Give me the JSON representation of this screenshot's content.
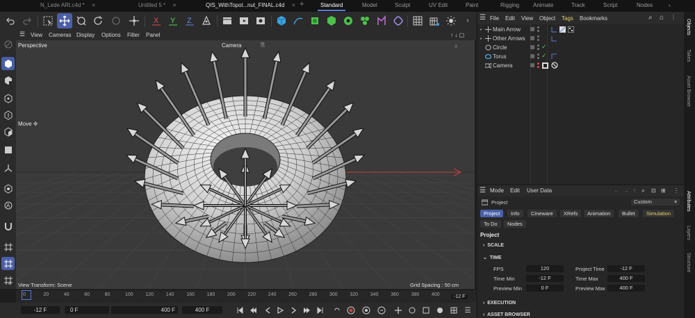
{
  "doc_tabs": [
    {
      "label": "N_Lede ARt.c4d *",
      "active": false
    },
    {
      "label": "Untitled 5 *",
      "active": false
    },
    {
      "label": "QIS_WithTopol...nut_FINAL.c4d",
      "active": true
    }
  ],
  "new_tab_symbol": "+",
  "layouts": [
    "Standard",
    "Model",
    "Sculpt",
    "UV Edit",
    "Paint",
    "Rigging",
    "Animate",
    "Track",
    "Script",
    "Nodes"
  ],
  "viewport_menu": {
    "items": [
      "View",
      "Cameras",
      "Display",
      "Options",
      "Filter",
      "Panel"
    ]
  },
  "viewport": {
    "view_name": "Perspective",
    "camera_label": "Camera",
    "tool_label": "Move",
    "transform_label": "View Transform: Scene",
    "grid_spacing": "Grid Spacing : 50 cm"
  },
  "timeline": {
    "ticks": [
      "0",
      "20",
      "40",
      "60",
      "80",
      "100",
      "120",
      "140",
      "160",
      "180",
      "200",
      "220",
      "240",
      "260",
      "280",
      "300",
      "320",
      "340",
      "360",
      "380",
      "400"
    ],
    "current_frame_badge": "-12 F",
    "start_field": "-12 F",
    "current_field": "0 F",
    "end_field": "400 F",
    "max_field": "400 F"
  },
  "object_manager": {
    "menu": [
      "File",
      "Edit",
      "View",
      "Object",
      "Tags",
      "Bookmarks"
    ],
    "objects": [
      {
        "name": "Main Arrow",
        "icon": "null-icon"
      },
      {
        "name": "Other Arrows",
        "icon": "null-icon"
      },
      {
        "name": "Circle",
        "icon": "circle-spline-icon"
      },
      {
        "name": "Torus",
        "icon": "torus-icon"
      },
      {
        "name": "Camera",
        "icon": "camera-icon"
      }
    ]
  },
  "attributes": {
    "menu": [
      "Mode",
      "Edit",
      "User Data"
    ],
    "object_label": "Project",
    "preset": "Custom",
    "tabs": [
      "Project",
      "Info",
      "Cineware",
      "XRefs",
      "Animation",
      "Bullet",
      "Simulation"
    ],
    "tabs_row2": [
      "To Do",
      "Nodes"
    ],
    "heading": "Project",
    "sections": {
      "scale": "SCALE",
      "time": "TIME",
      "execution": "EXECUTION",
      "asset_browser": "ASSET BROWSER"
    },
    "fields": {
      "fps_label": "FPS",
      "fps_value": "120",
      "project_time_label": "Project Time",
      "project_time_value": "-12 F",
      "time_min_label": "Time Min",
      "time_min_value": "-12 F",
      "time_max_label": "Time Max",
      "time_max_value": "400 F",
      "preview_min_label": "Preview Min",
      "preview_min_value": "0 F",
      "preview_max_label": "Preview Max",
      "preview_max_value": "400 F"
    }
  },
  "right_tabs": [
    "Objects",
    "Takes",
    "Asset Browser",
    "Attributes",
    "Layers",
    "Structure"
  ],
  "colors": {
    "accent": "#4a5fa8",
    "x_axis": "#c84040",
    "check": "#54c254",
    "simulation_tab": "#e3d06a"
  }
}
